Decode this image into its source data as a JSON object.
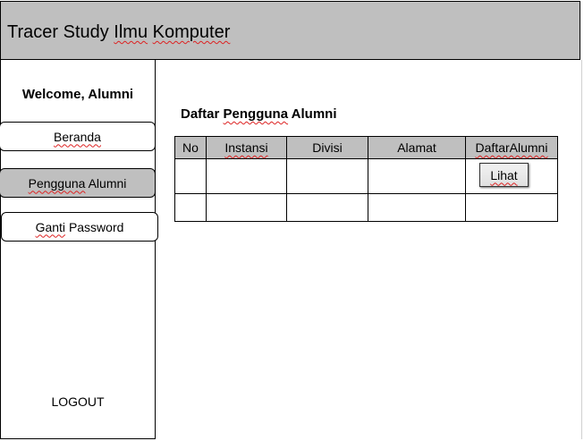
{
  "header": {
    "title_prefix": "Tracer Study ",
    "title_word1": "Ilmu",
    "title_space": " ",
    "title_word2": "Komputer"
  },
  "sidebar": {
    "welcome": "Welcome, Alumni",
    "items": [
      {
        "label": "Beranda",
        "active": false
      },
      {
        "label": "Pengguna Alumni",
        "active": true
      },
      {
        "label": "Ganti Password",
        "active": false
      }
    ],
    "logout": "LOGOUT"
  },
  "main": {
    "section_title": "Daftar Pengguna Alumni",
    "table": {
      "columns": [
        "No",
        "Instansi",
        "Divisi",
        "Alamat",
        "DaftarAlumni"
      ],
      "rows": [
        {
          "no": "",
          "instansi": "",
          "divisi": "",
          "alamat": "",
          "action": "Lihat"
        },
        {
          "no": "",
          "instansi": "",
          "divisi": "",
          "alamat": "",
          "action": ""
        }
      ]
    }
  },
  "colors": {
    "header_bg": "#bfbfbf",
    "active_nav_bg": "#bfbfbf",
    "spellcheck_underline": "#d22"
  }
}
